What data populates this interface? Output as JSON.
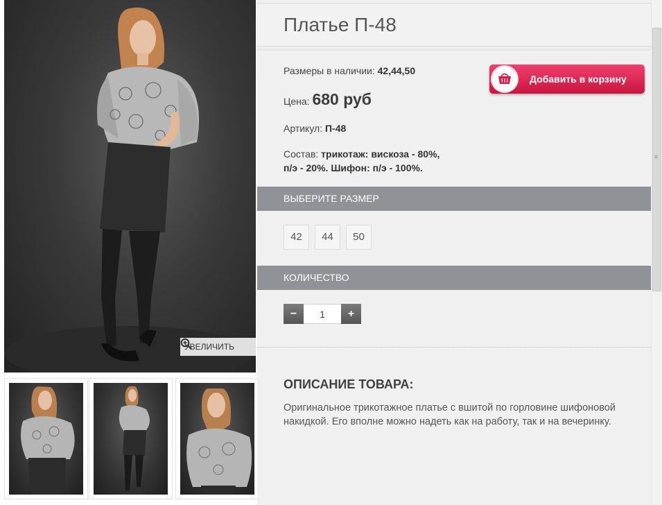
{
  "product": {
    "title": "Платье П-48",
    "sizes_label": "Размеры в наличии:",
    "sizes_value": "42,44,50",
    "price_label": "Цена:",
    "price_value": "680 руб",
    "article_label": "Артикул:",
    "article_value": "П-48",
    "composition_label": "Состав:",
    "composition_line1": "трикотаж: вискоза - 80%,",
    "composition_line2": "п/э - 20%. Шифон: п/э - 100%."
  },
  "cart_button": {
    "label": "Добавить в корзину",
    "icon": "basket-icon",
    "color": "#d81e4b"
  },
  "gallery": {
    "zoom_label": "УВЕЛИЧИТЬ",
    "zoom_icon": "magnifier-plus-icon"
  },
  "size_section": {
    "heading": "ВЫБЕРИТЕ РАЗМЕР",
    "options": [
      "42",
      "44",
      "50"
    ]
  },
  "quantity_section": {
    "heading": "КОЛИЧЕСТВО",
    "minus": "−",
    "plus": "+",
    "value": "1"
  },
  "description": {
    "heading": "ОПИСАНИЕ ТОВАРА:",
    "text": "Оригинальное трикотажное платье с вшитой по горловине шифоновой накидкой. Его вполне можно надеть как на работу, так и на вечеринку."
  },
  "colors": {
    "section_header": "#8f9296",
    "panel_bg": "#f0f0f0",
    "cart_accent": "#d81e4b"
  }
}
